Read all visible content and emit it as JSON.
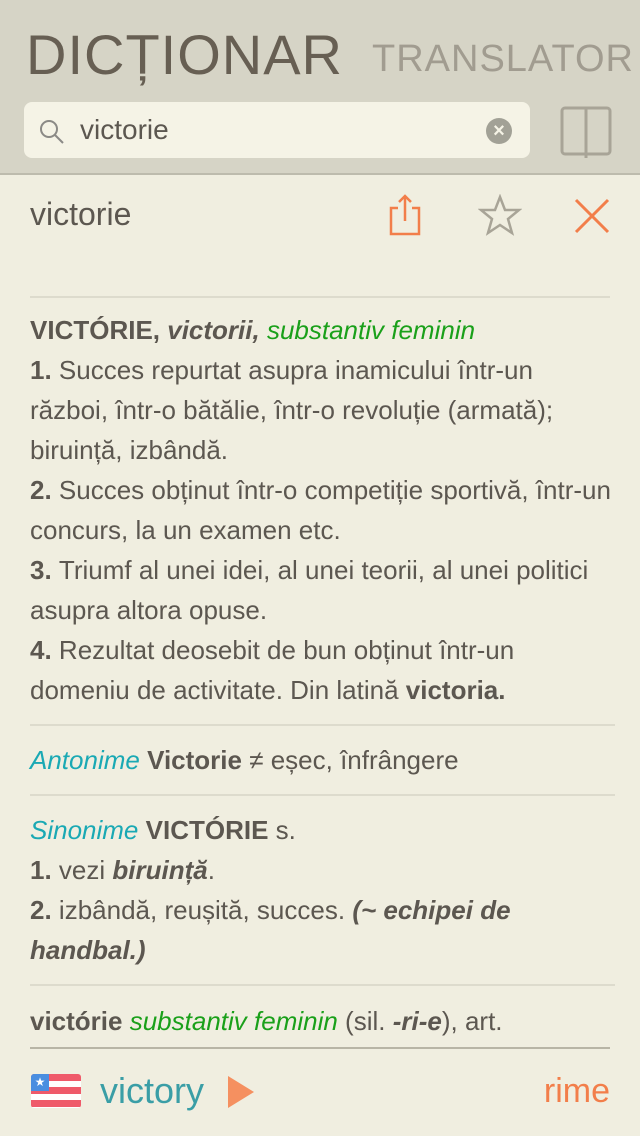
{
  "header": {
    "title": "DICȚIONAR",
    "subtitle": "TRANSLATOR"
  },
  "search": {
    "value": "victorie",
    "icon": "search-icon",
    "clear_icon": "clear-icon"
  },
  "entry": {
    "word": "victorie"
  },
  "definition": [
    [
      {
        "t": "VICTÓRIE, ",
        "s": "b"
      },
      {
        "t": "victorii, ",
        "s": "b i"
      },
      {
        "t": "substantiv feminin",
        "s": "i g"
      },
      {
        "t": "\n",
        "s": ""
      },
      {
        "t": "1. ",
        "s": "b"
      },
      {
        "t": "Succes repurtat asupra inamicului într-un război, într-o bătălie, într-o revoluție (armată); biruință, izbândă.",
        "s": ""
      },
      {
        "t": "\n",
        "s": ""
      },
      {
        "t": "2. ",
        "s": "b"
      },
      {
        "t": "Succes obținut într-o competiție sportivă, într-un concurs, la un examen etc.",
        "s": ""
      },
      {
        "t": "\n",
        "s": ""
      },
      {
        "t": "3. ",
        "s": "b"
      },
      {
        "t": "Triumf al unei idei, al unei teorii, al unei politici asupra altora opuse.",
        "s": ""
      },
      {
        "t": "\n",
        "s": ""
      },
      {
        "t": "4. ",
        "s": "b"
      },
      {
        "t": "Rezultat deosebit de bun obținut într-un domeniu de activitate. Din latină ",
        "s": ""
      },
      {
        "t": "victoria.",
        "s": "b"
      }
    ],
    [
      {
        "t": "Antonime ",
        "s": "i t"
      },
      {
        "t": "Victorie",
        "s": "b"
      },
      {
        "t": " ≠ eșec, înfrângere",
        "s": ""
      }
    ],
    [
      {
        "t": "Sinonime ",
        "s": "i t"
      },
      {
        "t": "VICTÓRIE",
        "s": "b"
      },
      {
        "t": " s.",
        "s": ""
      },
      {
        "t": "\n",
        "s": ""
      },
      {
        "t": "1. ",
        "s": "b"
      },
      {
        "t": "vezi ",
        "s": ""
      },
      {
        "t": "biruință",
        "s": "b i"
      },
      {
        "t": ".",
        "s": ""
      },
      {
        "t": "\n",
        "s": ""
      },
      {
        "t": "2. ",
        "s": "b"
      },
      {
        "t": "izbândă, reușită, succes. ",
        "s": ""
      },
      {
        "t": "(~ echipei de handbal.)",
        "s": "b i"
      }
    ]
  ],
  "last_line": [
    {
      "t": "victórie ",
      "s": "b"
    },
    {
      "t": "substantiv feminin",
      "s": "i g"
    },
    {
      "t": " (sil. ",
      "s": ""
    },
    {
      "t": "-ri-e",
      "s": "b i"
    },
    {
      "t": "), art.",
      "s": ""
    }
  ],
  "footer": {
    "translation": "victory",
    "rhymes": "rime",
    "flag": "us-flag-icon"
  },
  "colors": {
    "accent": "#f27e4a",
    "teal": "#1aa9b4",
    "green": "#1aa01a"
  }
}
